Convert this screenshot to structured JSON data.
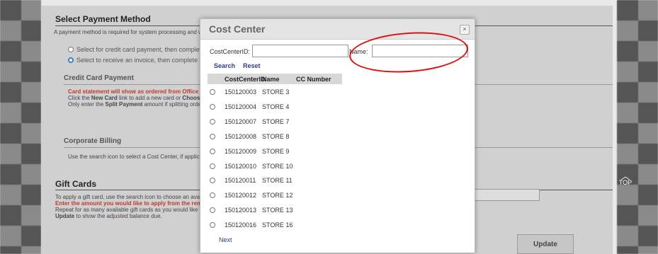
{
  "page": {
    "title": "Select Payment Method",
    "intro": "A payment method is required for system processing and wi",
    "option_card": "Select for credit card payment, then comple",
    "option_invoice": "Select to receive an invoice, then complete t",
    "credit_card": {
      "heading": "Credit Card Payment",
      "statement_note": "Card statement will show as ordered from Office Depot",
      "line2_pre": "Click the ",
      "new_card": "New Card",
      "line2_mid": " link to add a new card or ",
      "choose_card": "Choose Ca",
      "line3_pre": "Only enter the ",
      "split_payment": "Split Payment",
      "line3_post": " amount if splitting order to"
    },
    "corporate_billing": {
      "heading": "Corporate Billing",
      "text": "Use the search icon to select a Cost Center, if applicabl"
    },
    "gift_cards": {
      "heading": "Gift Cards",
      "line1": "To apply a gift card, use the search icon to choose an availat",
      "line2": "Enter the amount you would like to apply from the remaining",
      "line3": "Repeat for as many available gift cards as you would like to a",
      "update_word": "Update",
      "line4_post": " to show the adjusted balance due."
    },
    "update_button": "Update",
    "top_button": "TOP"
  },
  "modal": {
    "title": "Cost Center",
    "close": "×",
    "cost_center_id_label": "CostCenterID:",
    "name_label": "Name:",
    "cost_center_id_value": "",
    "name_value": "",
    "search": "Search",
    "reset": "Reset",
    "columns": [
      "CostCenterID",
      "Name",
      "CC Number"
    ],
    "rows": [
      {
        "id": "150120003",
        "name": "STORE 3",
        "cc": ""
      },
      {
        "id": "150120004",
        "name": "STORE 4",
        "cc": ""
      },
      {
        "id": "150120007",
        "name": "STORE 7",
        "cc": ""
      },
      {
        "id": "150120008",
        "name": "STORE 8",
        "cc": ""
      },
      {
        "id": "150120009",
        "name": "STORE 9",
        "cc": ""
      },
      {
        "id": "150120010",
        "name": "STORE 10",
        "cc": ""
      },
      {
        "id": "150120011",
        "name": "STORE 11",
        "cc": ""
      },
      {
        "id": "150120012",
        "name": "STORE 12",
        "cc": ""
      },
      {
        "id": "150120013",
        "name": "STORE 13",
        "cc": ""
      },
      {
        "id": "150120016",
        "name": "STORE 16",
        "cc": ""
      }
    ],
    "next": "Next"
  },
  "colors": {
    "annotation": "#e01010",
    "link": "#2a3a9a",
    "warning": "#c0392b",
    "radio_selected": "#3b7dd8"
  }
}
